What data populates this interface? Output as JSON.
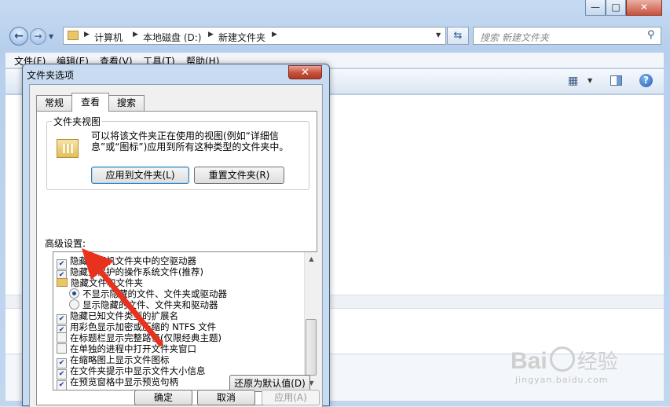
{
  "explorer": {
    "window_buttons": {
      "minimize": "—",
      "maximize": "□",
      "close": "✕"
    },
    "address": {
      "crumbs": [
        "计算机",
        "本地磁盘 (D:)",
        "新建文件夹"
      ]
    },
    "search_placeholder": "搜索 新建文件夹",
    "menu": [
      "文件(F)",
      "编辑(E)",
      "查看(V)",
      "工具(T)",
      "帮助(H)"
    ],
    "icons": {
      "back": "back-arrow-icon",
      "forward": "forward-arrow-icon",
      "folder": "folder-icon",
      "refresh": "refresh-icon",
      "search": "search-icon",
      "view": "view-options-icon",
      "preview": "preview-pane-icon",
      "help": "help-icon"
    }
  },
  "dialog": {
    "title": "文件夹选项",
    "close": "✕",
    "tabs": [
      "常规",
      "查看",
      "搜索"
    ],
    "active_tab": "查看",
    "folder_view": {
      "legend": "文件夹视图",
      "description": "可以将该文件夹正在使用的视图(例如“详细信息”或“图标”)应用到所有这种类型的文件夹中。",
      "apply_button": "应用到文件夹(L)",
      "reset_button": "重置文件夹(R)"
    },
    "advanced_label": "高级设置:",
    "settings": [
      {
        "kind": "checkbox",
        "checked": true,
        "text": "隐藏计算机文件夹中的空驱动器"
      },
      {
        "kind": "checkbox",
        "checked": true,
        "text": "隐藏受保护的操作系统文件(推荐)"
      },
      {
        "kind": "folder",
        "text": "隐藏文件和文件夹"
      },
      {
        "kind": "radio",
        "checked": true,
        "text": "不显示隐藏的文件、文件夹或驱动器"
      },
      {
        "kind": "radio",
        "checked": false,
        "text": "显示隐藏的文件、文件夹和驱动器"
      },
      {
        "kind": "checkbox",
        "checked": true,
        "text": "隐藏已知文件类型的扩展名"
      },
      {
        "kind": "checkbox",
        "checked": true,
        "text": "用彩色显示加密或压缩的 NTFS 文件"
      },
      {
        "kind": "checkbox",
        "checked": false,
        "text": "在标题栏显示完整路径(仅限经典主题)"
      },
      {
        "kind": "checkbox",
        "checked": false,
        "text": "在单独的进程中打开文件夹窗口"
      },
      {
        "kind": "checkbox",
        "checked": true,
        "text": "在缩略图上显示文件图标"
      },
      {
        "kind": "checkbox",
        "checked": true,
        "text": "在文件夹提示中显示文件大小信息"
      },
      {
        "kind": "checkbox",
        "checked": true,
        "text": "在预览窗格中显示预览句柄"
      }
    ],
    "restore_defaults": "还原为默认值(D)",
    "ok": "确定",
    "cancel": "取消",
    "apply": "应用(A)"
  },
  "annotation": {
    "arrow_color": "#e8321e"
  },
  "watermark": {
    "brand": "Bai",
    "brand_tail": "经验",
    "site": "jingyan.baidu.com"
  },
  "colors": {
    "title_bar": "#c6dbf3",
    "close_red": "#c7503a",
    "dialog_face": "#f0f0f0"
  }
}
